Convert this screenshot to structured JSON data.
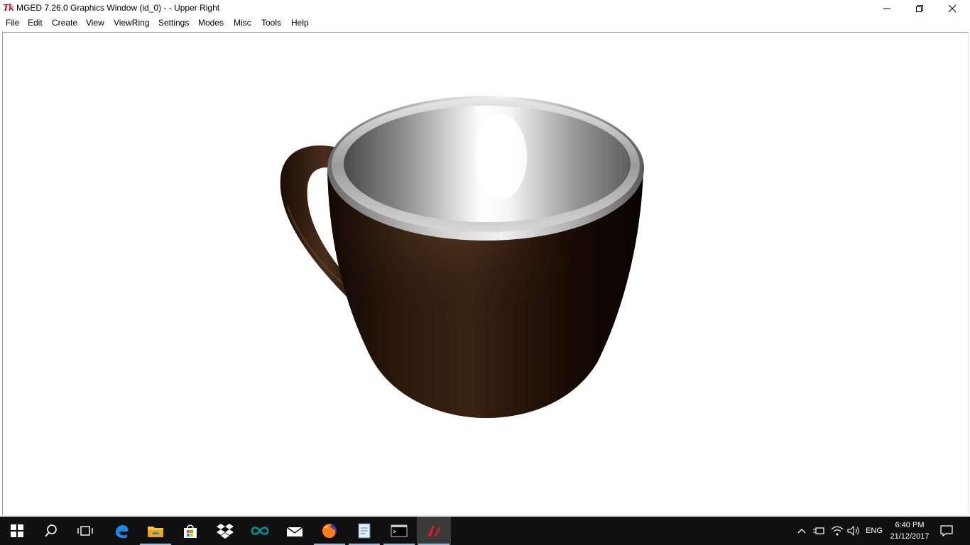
{
  "window": {
    "title": "MGED 7.26.0 Graphics Window (id_0) -  - Upper Right",
    "app_icon": "tk-feather-icon",
    "logo_text": "Tk"
  },
  "menubar": {
    "items": [
      {
        "label": "File"
      },
      {
        "label": "Edit"
      },
      {
        "label": "Create"
      },
      {
        "label": "View"
      },
      {
        "label": "ViewRing"
      },
      {
        "label": "Settings"
      },
      {
        "label": "Modes"
      },
      {
        "label": "Misc"
      },
      {
        "label": "Tools"
      },
      {
        "label": "Help"
      }
    ]
  },
  "scene": {
    "object": "coffee-cup",
    "background": "#ffffff",
    "cup_exterior_color": "#2a1609",
    "cup_interior_color": "#cfcfcf"
  },
  "taskbar": {
    "apps": [
      {
        "name": "start",
        "icon": "windows-logo-icon"
      },
      {
        "name": "search",
        "icon": "search-icon"
      },
      {
        "name": "task-view",
        "icon": "task-view-icon"
      },
      {
        "name": "edge",
        "icon": "edge-icon"
      },
      {
        "name": "file-explorer",
        "icon": "folder-icon",
        "running": true
      },
      {
        "name": "store",
        "icon": "store-bag-icon"
      },
      {
        "name": "dropbox",
        "icon": "dropbox-icon"
      },
      {
        "name": "arduino",
        "icon": "infinity-icon"
      },
      {
        "name": "mail",
        "icon": "mail-icon"
      },
      {
        "name": "firefox",
        "icon": "firefox-icon",
        "running": true
      },
      {
        "name": "wordpad",
        "icon": "document-icon",
        "running": true
      },
      {
        "name": "console",
        "icon": "console-icon",
        "running": true
      },
      {
        "name": "mged",
        "icon": "tk-feather-icon",
        "running": true,
        "active": true
      }
    ],
    "tray": {
      "lang": "ENG",
      "time": "6:40 PM",
      "date": "21/12/2017"
    }
  }
}
